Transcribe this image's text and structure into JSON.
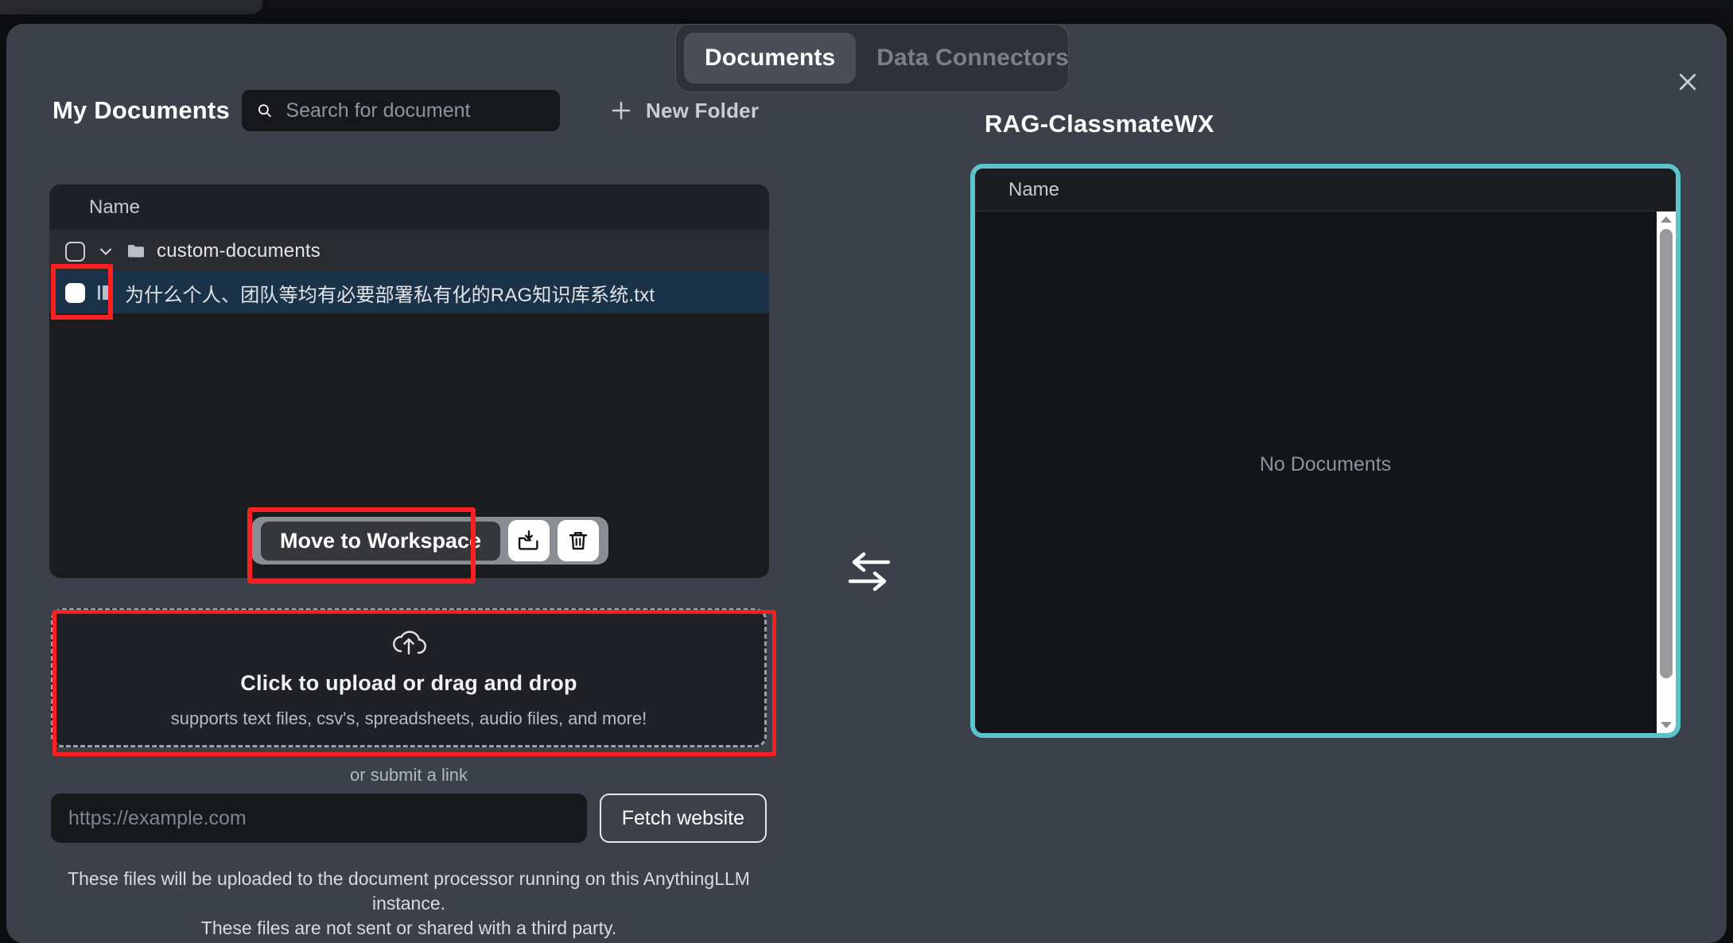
{
  "tabs": [
    {
      "label": "Documents",
      "active": true
    },
    {
      "label": "Data Connectors",
      "active": false
    }
  ],
  "left_panel": {
    "title": "My Documents",
    "search": {
      "placeholder": "Search for document",
      "value": ""
    },
    "new_folder_label": "New Folder",
    "file_browser": {
      "column_header": "Name",
      "rows": [
        {
          "type": "folder",
          "label": "custom-documents",
          "checked": false,
          "expanded": true
        },
        {
          "type": "file",
          "label": "为什么个人、团队等均有必要部署私有化的RAG知识库系统.txt",
          "checked": true,
          "selected": true
        }
      ]
    },
    "action_bar": {
      "move_label": "Move to Workspace",
      "move_folder_icon": "folder-download-icon",
      "delete_icon": "trash-icon"
    },
    "dropzone": {
      "icon": "cloud-upload-icon",
      "title": "Click to upload or drag and drop",
      "subtitle": "supports text files, csv's, spreadsheets, audio files, and more!"
    },
    "or_submit_label": "or submit a link",
    "link_input": {
      "placeholder": "https://example.com",
      "value": ""
    },
    "fetch_button_label": "Fetch website",
    "disclaimer_line1": "These files will be uploaded to the document processor running on this AnythingLLM instance.",
    "disclaimer_line2": "These files are not sent or shared with a third party."
  },
  "transfer_icon": "transfer-arrows-icon",
  "right_panel": {
    "title": "RAG-ClassmateWX",
    "column_header": "Name",
    "empty_state": "No Documents"
  },
  "close_icon": "close-icon",
  "colors": {
    "modal_bg": "#3c4049",
    "panel_bg": "#1b1c20",
    "accent_teal": "#5cc4ce",
    "annotation_red": "#ff1f1f",
    "selected_row": "#1b3349",
    "active_tab": "#4a4e57"
  }
}
